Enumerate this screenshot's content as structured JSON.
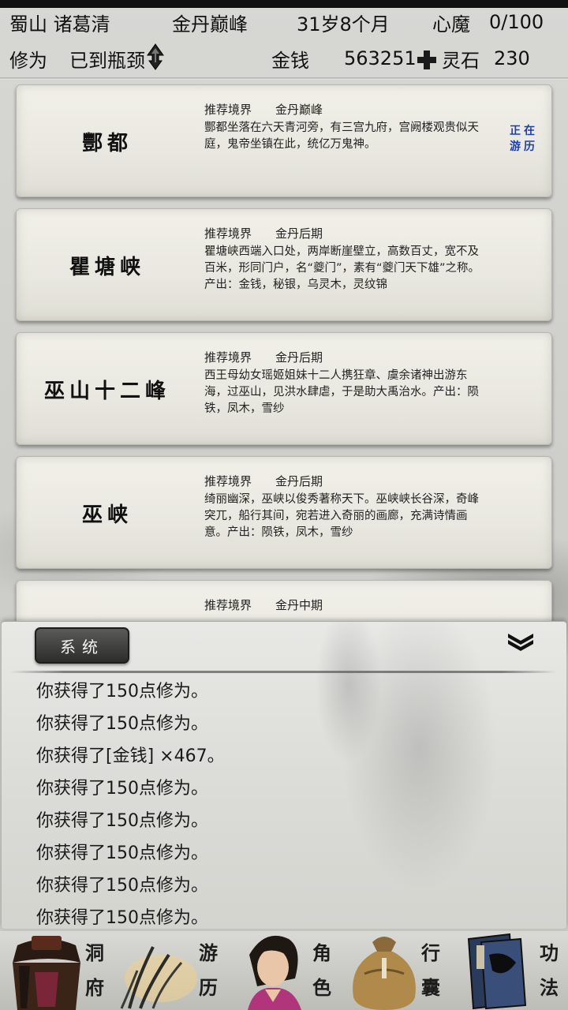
{
  "header": {
    "location_name": "蜀山 诸葛清",
    "realm": "金丹巅峰",
    "age": "31岁8个月",
    "heart_demon_label": "心魔",
    "heart_demon_value": "0/100",
    "cultivation_label": "修为",
    "cultivation_status": "已到瓶颈",
    "money_label": "金钱",
    "money_value": "563251",
    "spirit_stone_label": "灵石",
    "spirit_stone_value": "230"
  },
  "regions": [
    {
      "name": "酆都",
      "rec_label": "推荐境界",
      "rec_realm": "金丹巅峰",
      "description": "酆都坐落在六天青河旁，有三宫九府，宫阙楼观贵似天庭，鬼帝坐镇在此，统亿万鬼神。",
      "current_line1": "正在",
      "current_line2": "游历"
    },
    {
      "name": "瞿塘峡",
      "rec_label": "推荐境界",
      "rec_realm": "金丹后期",
      "description": "瞿塘峡西端入口处，两岸断崖壁立，高数百丈，宽不及百米，形同门户，名“夔门”，素有“夔门天下雄”之称。产出：金钱，秘银，乌灵木，灵纹锦"
    },
    {
      "name": "巫山十二峰",
      "rec_label": "推荐境界",
      "rec_realm": "金丹后期",
      "description": "西王母幼女瑶姬姐妹十二人携狂章、虞余诸神出游东海，过巫山，见洪水肆虐，于是助大禹治水。产出：陨铁，凤木，雪纱"
    },
    {
      "name": "巫峡",
      "rec_label": "推荐境界",
      "rec_realm": "金丹后期",
      "description": "绮丽幽深，巫峡以俊秀著称天下。巫峡峡长谷深，奇峰突兀，船行其间，宛若进入奇丽的画廊，充满诗情画意。产出：陨铁，凤木，雪纱"
    },
    {
      "name": "",
      "rec_label": "推荐境界",
      "rec_realm": "金丹中期",
      "description": ""
    }
  ],
  "log": {
    "tab_label": "系统",
    "lines": [
      "你获得了150点修为。",
      "你获得了150点修为。",
      "你获得了[金钱] ×467。",
      "你获得了150点修为。",
      "你获得了150点修为。",
      "你获得了150点修为。",
      "你获得了150点修为。",
      "你获得了150点修为。"
    ]
  },
  "nav": {
    "dongfu_1": "洞",
    "dongfu_2": "府",
    "youli_1": "游",
    "youli_2": "历",
    "juese_1": "角",
    "juese_2": "色",
    "xingnang_1": "行",
    "xingnang_2": "囊",
    "gongfa_1": "功",
    "gongfa_2": "法"
  },
  "colors": {
    "current_badge": "#1a3fb0",
    "card_bg": "#ecebe3",
    "tab_bg": "#3a3a38"
  }
}
